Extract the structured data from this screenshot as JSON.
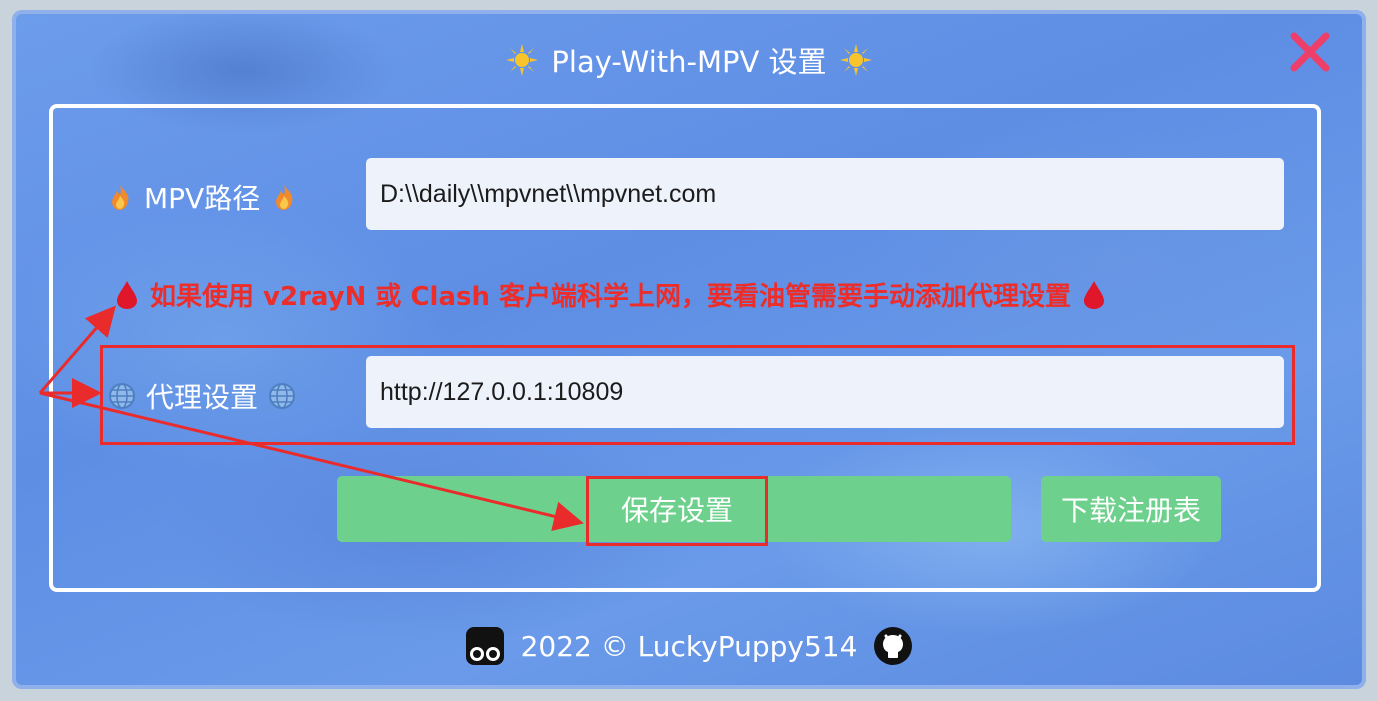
{
  "dialog": {
    "title": "Play-With-MPV 设置",
    "title_icon": "sun-icon",
    "close_icon": "close-icon"
  },
  "mpv_path": {
    "label": "MPV路径",
    "label_icon": "fire-icon",
    "value": "D:\\\\daily\\\\mpvnet\\\\mpvnet.com"
  },
  "notice": {
    "text": "如果使用 v2rayN 或 Clash 客户端科学上网，要看油管需要手动添加代理设置",
    "icon": "blood-drop-icon"
  },
  "proxy": {
    "label": "代理设置",
    "label_icon": "globe-icon",
    "value": "http://127.0.0.1:10809"
  },
  "buttons": {
    "save_label": "保存设置",
    "download_label": "下载注册表"
  },
  "footer": {
    "text": "2022 © LuckyPuppy514",
    "left_icon": "tampermonkey-icon",
    "right_icon": "github-icon"
  },
  "colors": {
    "background": "#6a9ae9",
    "notice_red": "#ec2d2a",
    "button_green": "#6dd08c",
    "annotation_red": "#ea2b2b"
  }
}
